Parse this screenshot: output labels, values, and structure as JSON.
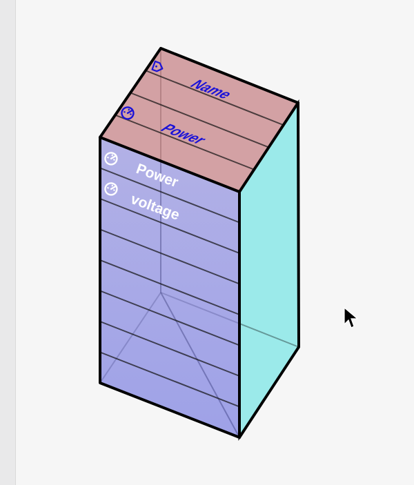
{
  "viewport": {
    "colors": {
      "top_face": "#c9898d",
      "right_face": "#5fe3e3",
      "front_face_top": "#8e8cde",
      "front_face_bottom": "#7a7de0",
      "outline": "#000000",
      "grid": "#222222",
      "top_label": "#1a12d8",
      "front_label": "#ffffff",
      "canvas_bg": "#f6f6f6"
    }
  },
  "top_face": {
    "rows": [
      {
        "icon": "tag-icon",
        "label": "Name"
      },
      {
        "icon": "gauge-icon",
        "label": "Power"
      }
    ]
  },
  "front_face": {
    "rows": [
      {
        "icon": "gauge-icon",
        "label": "Power"
      },
      {
        "icon": "gauge-icon",
        "label": "voltage"
      }
    ]
  },
  "cursor": {
    "visible": true
  }
}
